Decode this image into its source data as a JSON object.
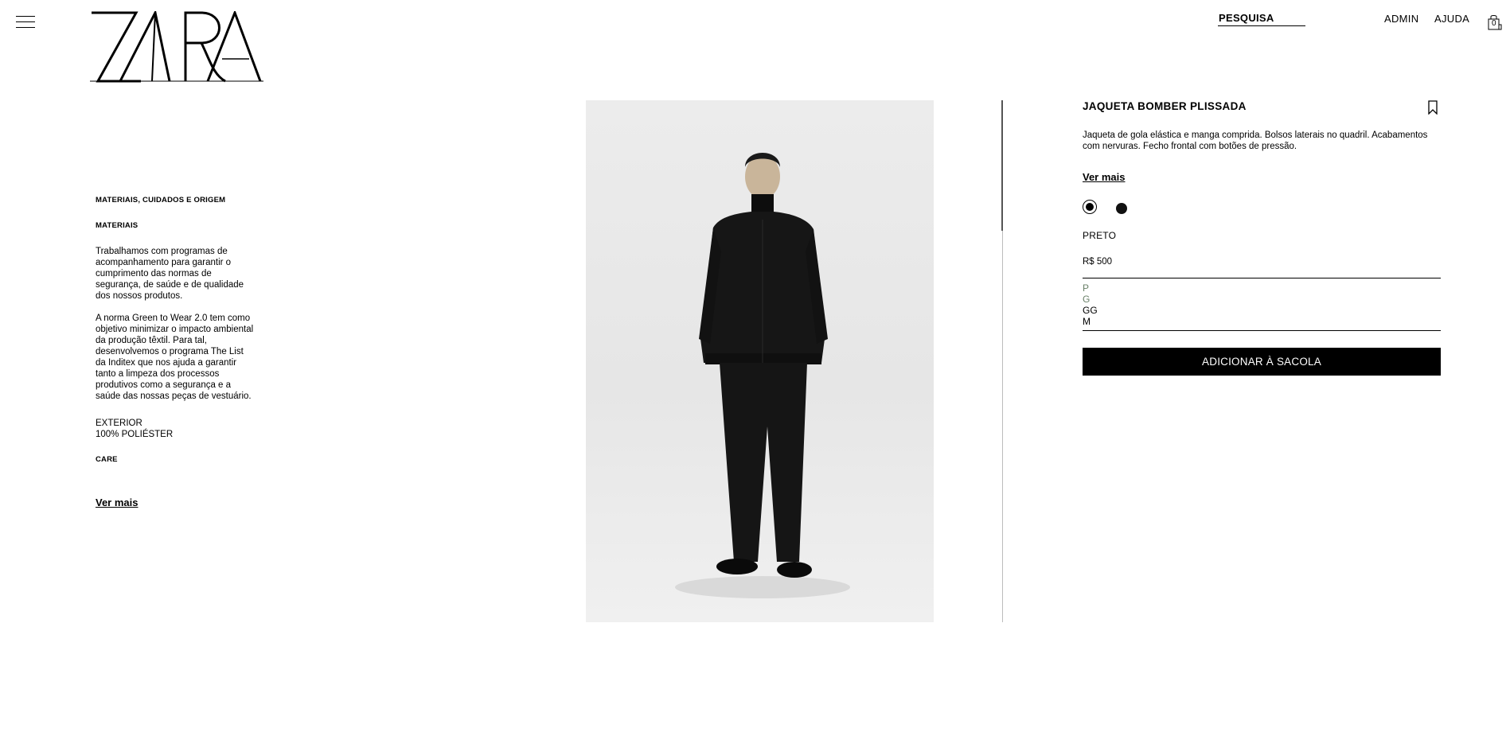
{
  "header": {
    "logo_text": "ZARA",
    "search_label": "PESQUISA",
    "nav": [
      "ADMIN",
      "AJUDA"
    ],
    "bag_count": "0"
  },
  "info": {
    "section_title": "MATERIAIS, CUIDADOS E ORIGEM",
    "materials_title": "MATERIAIS",
    "paragraph_1": "Trabalhamos com programas de acompanhamento para garantir o cumprimento das normas de segurança, de saúde e de qualidade dos nossos produtos.",
    "paragraph_2": "A norma Green to Wear 2.0 tem como objetivo minimizar o impacto ambiental da produção têxtil. Para tal, desenvolvemos o programa The List da Inditex que nos ajuda a garantir tanto a limpeza dos processos produtivos como a segurança e a saúde das nossas peças de vestuário.",
    "exterior_label": "EXTERIOR",
    "exterior_value": "100% POLIÉSTER",
    "care_title": "CARE",
    "see_more": "Ver mais"
  },
  "product": {
    "title": "JAQUETA BOMBER PLISSADA",
    "description": "Jaqueta de gola elástica e manga comprida. Bolsos laterais no quadril. Acabamentos com nervuras. Fecho frontal com botões de pressão.",
    "see_more": "Ver mais",
    "color_name": "PRETO",
    "price": "R$ 500",
    "sizes": [
      {
        "label": "P",
        "available": false
      },
      {
        "label": "G",
        "available": false
      },
      {
        "label": "GG",
        "available": true
      },
      {
        "label": "M",
        "available": true
      }
    ],
    "add_to_bag": "ADICIONAR À SACOLA",
    "colors": {
      "selected": "#000000",
      "alt": "#111111"
    }
  }
}
